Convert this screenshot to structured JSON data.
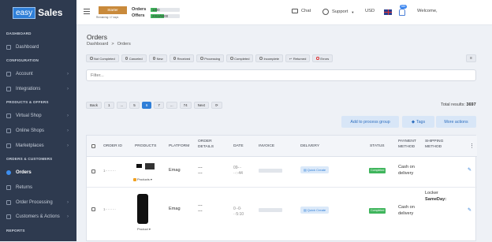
{
  "sidebar": {
    "logo_box": "easy",
    "logo_text": "Sales",
    "sections": {
      "dashboard": "DASHBOARD",
      "configuration": "CONFIGURATION",
      "products_offers": "PRODUCTS & OFFERS",
      "orders_customers": "ORDERS & CUSTOMERS",
      "reports": "REPORTS"
    },
    "items": {
      "dashboard": "Dashboard",
      "account": "Account",
      "integrations": "Integrations",
      "virtual_shop": "Virtual Shop",
      "online_shops": "Online Shops",
      "marketplaces": "Marketplaces",
      "orders": "Orders",
      "returns": "Returns",
      "order_processing": "Order Processing",
      "customers_actions": "Customers & Actions"
    }
  },
  "topbar": {
    "plan_label": "Starter",
    "plan_note": "Remaining: 17 days",
    "orders_label": "Orders",
    "offers_label": "Offers",
    "orders_usage": "1300",
    "offers_usage": "2311/5000",
    "orders_fill": 0.22,
    "offers_fill": 0.46,
    "chat": "Chat",
    "support": "Support",
    "currency": "USD",
    "notif_count": "360",
    "welcome": "Welcome,"
  },
  "page": {
    "title": "Orders",
    "breadcrumb_home": "Dashboard",
    "breadcrumb_sep": ">",
    "breadcrumb_current": "Orders"
  },
  "filters": [
    "Not Completed",
    "Canceled",
    "New",
    "Received",
    "Processing",
    "Completed",
    "Incomplete",
    "Returned",
    "Errors"
  ],
  "search": {
    "placeholder": "Filter..."
  },
  "pager": {
    "back": "Back",
    "pages": [
      "1",
      "...",
      "5",
      "6",
      "7",
      "...",
      "74"
    ],
    "current": "6",
    "next": "Next",
    "refresh_icon": "refresh-icon"
  },
  "total": {
    "label": "Total results:",
    "value": "3697"
  },
  "actions": {
    "add_process": "Add to process group",
    "tags": "Tags",
    "more": "More actions"
  },
  "table": {
    "headers": {
      "order_id": "ORDER ID",
      "products": "PRODUCTS",
      "platform": "PLATFORM",
      "order_details_1": "ORDER",
      "order_details_2": "DETAILS",
      "date": "DATE",
      "invoice": "INVOICE",
      "delivery": "DELIVERY",
      "status": "STATUS",
      "payment_1": "PAYMENT",
      "payment_2": "METHOD",
      "shipping_1": "SHIPPING",
      "shipping_2": "METHOD",
      "menu": "⋮"
    },
    "rows": [
      {
        "order_id": "1·········",
        "products_label": "Products",
        "platform": "Emag",
        "details_a": "---",
        "details_b": "---",
        "date_a": "09-··",
        "date_b": "··:·44",
        "delivery_btn": "Quick Create",
        "status": "Completed",
        "payment_1": "Cash on",
        "payment_2": "delivery",
        "shipping": ""
      },
      {
        "order_id": "1·········",
        "products_label": "Product",
        "platform": "Emag",
        "details_a": "---",
        "details_b": "---",
        "date_a": "0·-0·",
        "date_b": "··5:10",
        "delivery_btn": "Quick Create",
        "status": "Completed",
        "payment_1": "Cash on",
        "payment_2": "delivery",
        "shipping_1": "Locker",
        "shipping_2": "SameDay:"
      }
    ]
  },
  "colors": {
    "sidebar_bg": "#2e3a4f",
    "accent": "#2f7fd8",
    "status_green": "#3fb55c",
    "plan_orange": "#c98a3b"
  }
}
